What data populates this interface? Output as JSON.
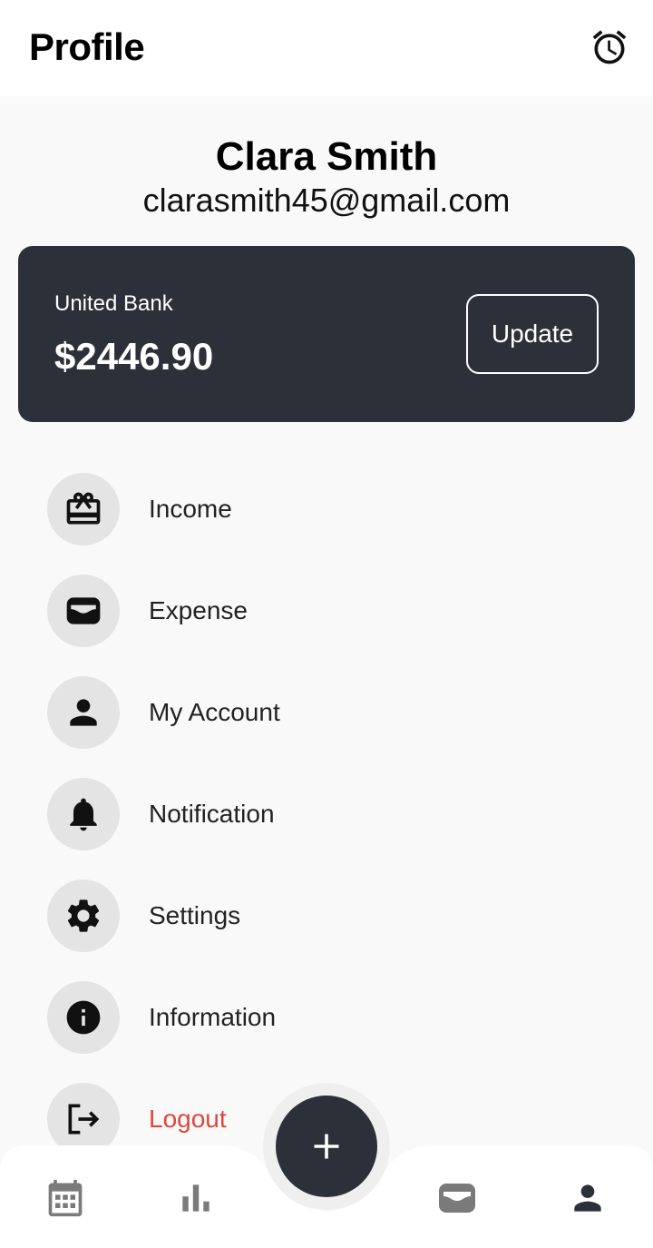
{
  "header": {
    "title": "Profile",
    "alarm_icon": "alarm-clock-icon"
  },
  "user": {
    "name": "Clara Smith",
    "email": "clarasmith45@gmail.com"
  },
  "bank_card": {
    "bank_name": "United Bank",
    "balance": "$2446.90",
    "update_label": "Update"
  },
  "menu": {
    "items": [
      {
        "label": "Income",
        "icon": "gift-card-icon"
      },
      {
        "label": "Expense",
        "icon": "wallet-icon"
      },
      {
        "label": "My Account",
        "icon": "person-icon"
      },
      {
        "label": "Notification",
        "icon": "bell-icon"
      },
      {
        "label": "Settings",
        "icon": "gear-icon"
      },
      {
        "label": "Information",
        "icon": "info-icon"
      },
      {
        "label": "Logout",
        "icon": "logout-icon"
      }
    ]
  },
  "bottom_nav": {
    "items": [
      {
        "icon": "calendar-icon"
      },
      {
        "icon": "bar-chart-icon"
      },
      {
        "icon": "wallet-icon"
      },
      {
        "icon": "person-icon"
      }
    ],
    "fab_icon": "plus-icon"
  },
  "colors": {
    "card_bg": "#2c3038",
    "logout": "#e0463c",
    "page_bg": "#f9f9f9"
  }
}
